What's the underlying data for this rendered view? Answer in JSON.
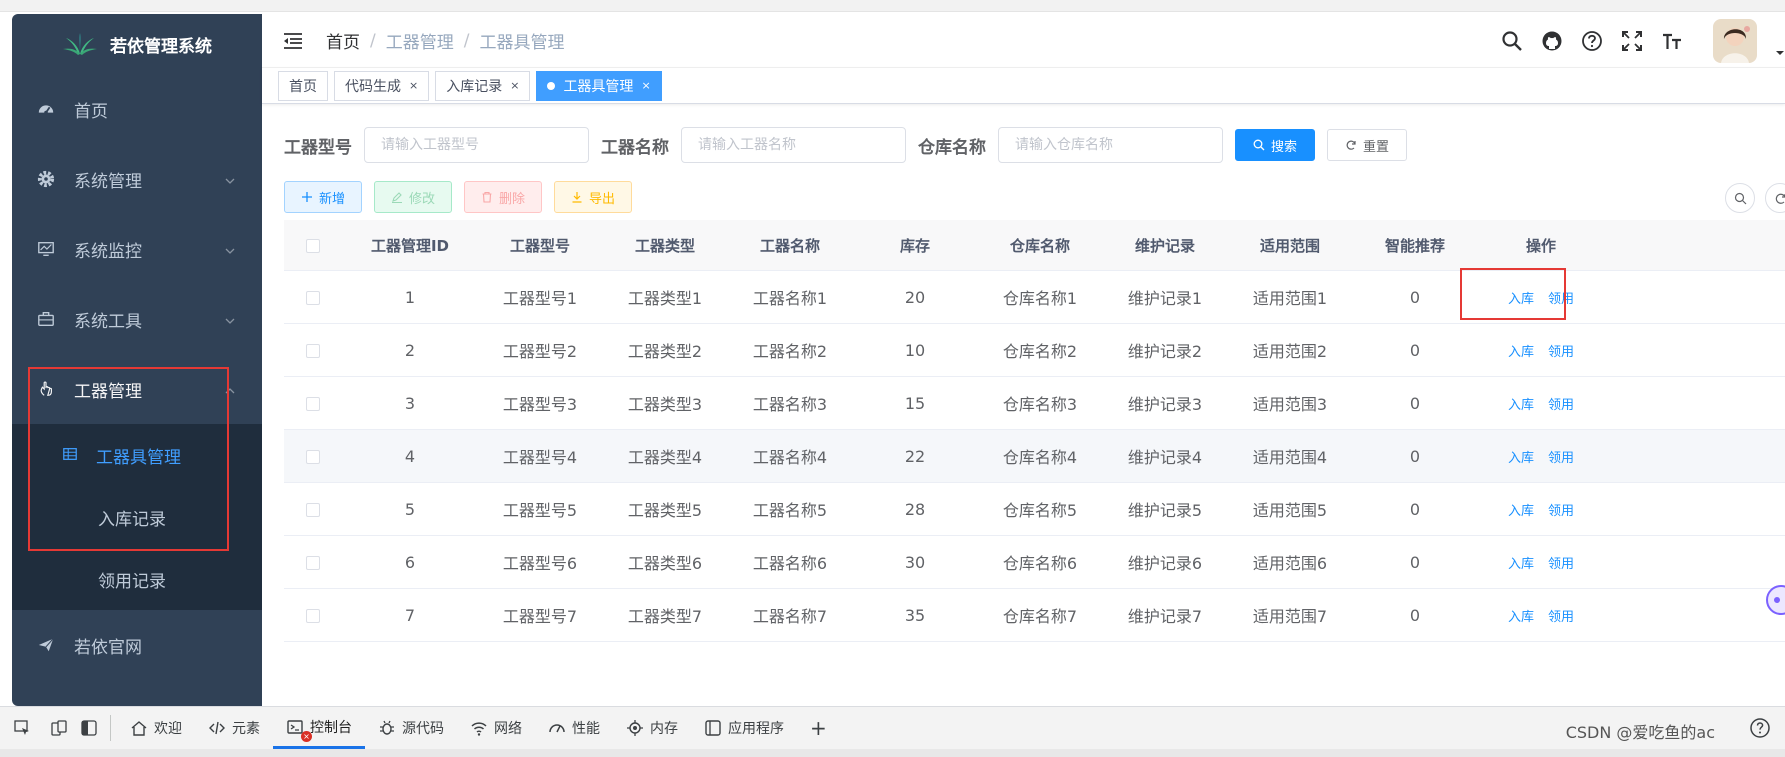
{
  "app": {
    "logo_text": "若依管理系统"
  },
  "sidebar": {
    "items": [
      {
        "label": "首页",
        "icon": "dashboard-icon"
      },
      {
        "label": "系统管理",
        "icon": "gear-icon"
      },
      {
        "label": "系统监控",
        "icon": "monitor-icon"
      },
      {
        "label": "系统工具",
        "icon": "toolbox-icon"
      },
      {
        "label": "工器管理",
        "icon": "hand-pointer-icon"
      }
    ],
    "submenu": [
      {
        "label": "工器具管理",
        "icon": "table-grid-icon",
        "active": true
      },
      {
        "label": "入库记录"
      },
      {
        "label": "领用记录"
      }
    ],
    "external": {
      "label": "若依官网",
      "icon": "send-icon"
    }
  },
  "header": {
    "breadcrumb": [
      "首页",
      "工器管理",
      "工器具管理"
    ],
    "separator": "/",
    "tools": [
      "search-icon",
      "github-icon",
      "question-icon",
      "fullscreen-icon",
      "font-size-icon"
    ]
  },
  "tags": [
    {
      "label": "首页",
      "closable": false
    },
    {
      "label": "代码生成",
      "closable": true
    },
    {
      "label": "入库记录",
      "closable": true
    },
    {
      "label": "工器具管理",
      "closable": true,
      "active": true
    }
  ],
  "tag_close": "×",
  "search": {
    "model_label": "工器型号",
    "model_placeholder": "请输入工器型号",
    "name_label": "工器名称",
    "name_placeholder": "请输入工器名称",
    "warehouse_label": "仓库名称",
    "warehouse_placeholder": "请输入仓库名称",
    "search_button": "搜索",
    "reset_button": "重置"
  },
  "toolbar": {
    "add": "新增",
    "edit": "修改",
    "delete": "删除",
    "export": "导出"
  },
  "table": {
    "headers": [
      "工器管理ID",
      "工器型号",
      "工器类型",
      "工器名称",
      "库存",
      "仓库名称",
      "维护记录",
      "适用范围",
      "智能推荐",
      "操作"
    ],
    "op_in": "入库",
    "op_use": "领用",
    "rows": [
      {
        "id": "1",
        "model": "工器型号1",
        "type": "工器类型1",
        "name": "工器名称1",
        "stock": "20",
        "warehouse": "仓库名称1",
        "maint": "维护记录1",
        "scope": "适用范围1",
        "rec": "0"
      },
      {
        "id": "2",
        "model": "工器型号2",
        "type": "工器类型2",
        "name": "工器名称2",
        "stock": "10",
        "warehouse": "仓库名称2",
        "maint": "维护记录2",
        "scope": "适用范围2",
        "rec": "0"
      },
      {
        "id": "3",
        "model": "工器型号3",
        "type": "工器类型3",
        "name": "工器名称3",
        "stock": "15",
        "warehouse": "仓库名称3",
        "maint": "维护记录3",
        "scope": "适用范围3",
        "rec": "0"
      },
      {
        "id": "4",
        "model": "工器型号4",
        "type": "工器类型4",
        "name": "工器名称4",
        "stock": "22",
        "warehouse": "仓库名称4",
        "maint": "维护记录4",
        "scope": "适用范围4",
        "rec": "0"
      },
      {
        "id": "5",
        "model": "工器型号5",
        "type": "工器类型5",
        "name": "工器名称5",
        "stock": "28",
        "warehouse": "仓库名称5",
        "maint": "维护记录5",
        "scope": "适用范围5",
        "rec": "0"
      },
      {
        "id": "6",
        "model": "工器型号6",
        "type": "工器类型6",
        "name": "工器名称6",
        "stock": "30",
        "warehouse": "仓库名称6",
        "maint": "维护记录6",
        "scope": "适用范围6",
        "rec": "0"
      },
      {
        "id": "7",
        "model": "工器型号7",
        "type": "工器类型7",
        "name": "工器名称7",
        "stock": "35",
        "warehouse": "仓库名称7",
        "maint": "维护记录7",
        "scope": "适用范围7",
        "rec": "0"
      }
    ]
  },
  "devtools": {
    "tabs": [
      {
        "label": "欢迎",
        "icon": "home-icon"
      },
      {
        "label": "元素",
        "icon": "code-icon"
      },
      {
        "label": "控制台",
        "icon": "console-icon",
        "active": true
      },
      {
        "label": "源代码",
        "icon": "bug-icon"
      },
      {
        "label": "网络",
        "icon": "wifi-icon"
      },
      {
        "label": "性能",
        "icon": "gauge-icon"
      },
      {
        "label": "内存",
        "icon": "chip-icon"
      },
      {
        "label": "应用程序",
        "icon": "app-window-icon"
      }
    ],
    "add_tab": "+",
    "error_badge": "×"
  },
  "watermark": "CSDN @爱吃鱼的ac",
  "colors": {
    "sidebar_bg": "#304156",
    "submenu_bg": "#1f2d3d",
    "accent": "#1890ff",
    "highlight_box": "#e53935"
  }
}
